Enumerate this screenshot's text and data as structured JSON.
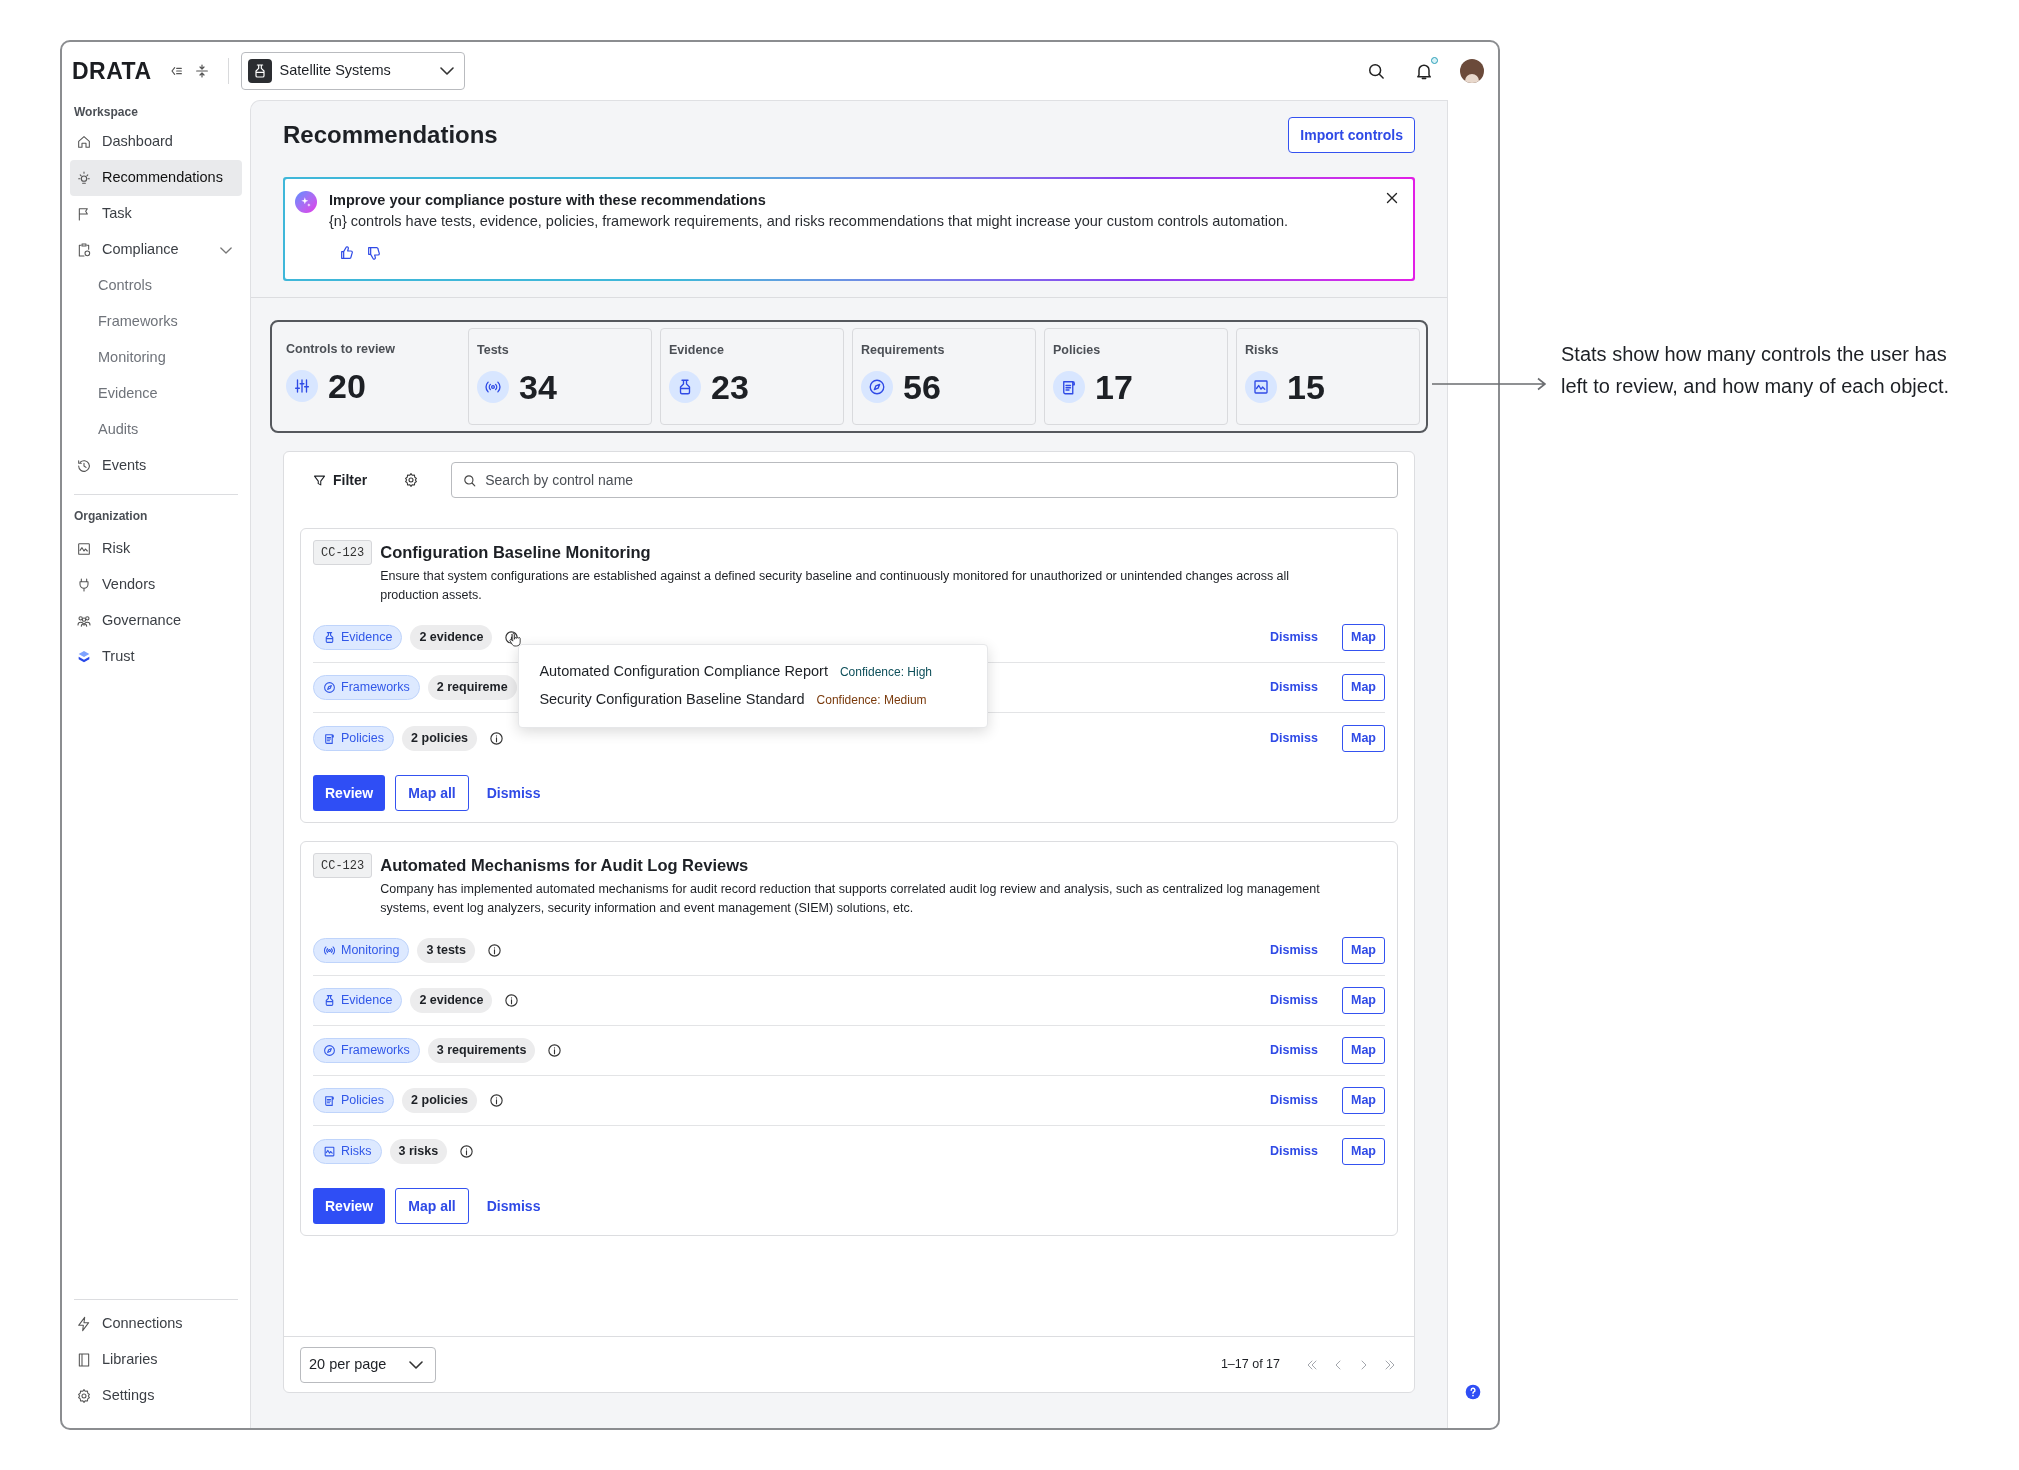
{
  "header": {
    "logo": "DRATA",
    "workspace": "Satellite Systems",
    "notification_dot": true
  },
  "sidebar": {
    "sections": [
      {
        "heading": "Workspace",
        "items": [
          {
            "label": "Dashboard",
            "selected": false
          },
          {
            "label": "Recommendations",
            "selected": true
          },
          {
            "label": "Task",
            "selected": false
          },
          {
            "label": "Compliance",
            "selected": false,
            "expanded": true,
            "children": [
              {
                "label": "Controls",
                "selected": false
              },
              {
                "label": "Frameworks",
                "selected": false
              },
              {
                "label": "Monitoring",
                "selected": false
              },
              {
                "label": "Evidence",
                "selected": false
              },
              {
                "label": "Audits",
                "selected": false
              }
            ]
          },
          {
            "label": "Events",
            "selected": false
          }
        ]
      },
      {
        "heading": "Organization",
        "items": [
          {
            "label": "Risk",
            "selected": false
          },
          {
            "label": "Vendors",
            "selected": false
          },
          {
            "label": "Governance",
            "selected": false
          },
          {
            "label": "Trust",
            "selected": false
          }
        ]
      }
    ],
    "footer_items": [
      {
        "label": "Connections",
        "selected": false
      },
      {
        "label": "Libraries",
        "selected": false
      },
      {
        "label": "Settings",
        "selected": false
      }
    ]
  },
  "page": {
    "title": "Recommendations",
    "import_button": "Import controls"
  },
  "banner": {
    "title": "Improve your compliance posture with these recommendations",
    "text": "{n} controls have tests, evidence, policies, framework requirements, and risks recommendations that might increase your custom controls automation."
  },
  "stats": [
    {
      "kind": "controls",
      "label": "Controls to review",
      "value": "20"
    },
    {
      "kind": "tests",
      "label": "Tests",
      "value": "34"
    },
    {
      "kind": "evidence",
      "label": "Evidence",
      "value": "23"
    },
    {
      "kind": "requirements",
      "label": "Requirements",
      "value": "56"
    },
    {
      "kind": "policies",
      "label": "Policies",
      "value": "17"
    },
    {
      "kind": "risks",
      "label": "Risks",
      "value": "15"
    }
  ],
  "filter": {
    "button": "Filter",
    "search_placeholder": "Search by control name"
  },
  "controls": [
    {
      "id": "CC-123",
      "title": "Configuration Baseline Monitoring",
      "description": "Ensure that system configurations are established against a defined security baseline and continuously monitored for unauthorized or unintended changes across all production assets.",
      "recommendations": [
        {
          "kind": "evidence",
          "label": "Evidence",
          "count": "2 evidence",
          "dismiss": "Dismiss",
          "map": "Map",
          "tooltip": [
            {
              "name": "Automated Configuration Compliance Report",
              "confidence": "Confidence: High",
              "color": "#0e4f5a"
            },
            {
              "name": "Security Configuration Baseline Standard",
              "confidence": "Confidence: Medium",
              "color": "#7a3a0c"
            }
          ]
        },
        {
          "kind": "frameworks",
          "label": "Frameworks",
          "count": "2 requireme",
          "dismiss": "Dismiss",
          "map": "Map"
        },
        {
          "kind": "policies",
          "label": "Policies",
          "count": "2 policies",
          "dismiss": "Dismiss",
          "map": "Map"
        }
      ],
      "review": "Review",
      "map_all": "Map all",
      "dismiss": "Dismiss"
    },
    {
      "id": "CC-123",
      "title": "Automated Mechanisms for Audit Log Reviews",
      "description": "Company has implemented automated mechanisms for audit record reduction that supports correlated audit log review and analysis, such as centralized log management systems, event log analyzers, security information and event management (SIEM) solutions, etc.",
      "recommendations": [
        {
          "kind": "monitoring",
          "label": "Monitoring",
          "count": "3 tests",
          "dismiss": "Dismiss",
          "map": "Map"
        },
        {
          "kind": "evidence",
          "label": "Evidence",
          "count": "2 evidence",
          "dismiss": "Dismiss",
          "map": "Map"
        },
        {
          "kind": "frameworks",
          "label": "Frameworks",
          "count": "3 requirements",
          "dismiss": "Dismiss",
          "map": "Map"
        },
        {
          "kind": "policies",
          "label": "Policies",
          "count": "2 policies",
          "dismiss": "Dismiss",
          "map": "Map"
        },
        {
          "kind": "risks",
          "label": "Risks",
          "count": "3 risks",
          "dismiss": "Dismiss",
          "map": "Map"
        }
      ],
      "review": "Review",
      "map_all": "Map all",
      "dismiss": "Dismiss"
    }
  ],
  "pagination": {
    "per_page": "20 per page",
    "range": "1–17 of 17"
  },
  "annotation": {
    "text": "Stats show how many controls the user has left to review, and how many of each object."
  }
}
